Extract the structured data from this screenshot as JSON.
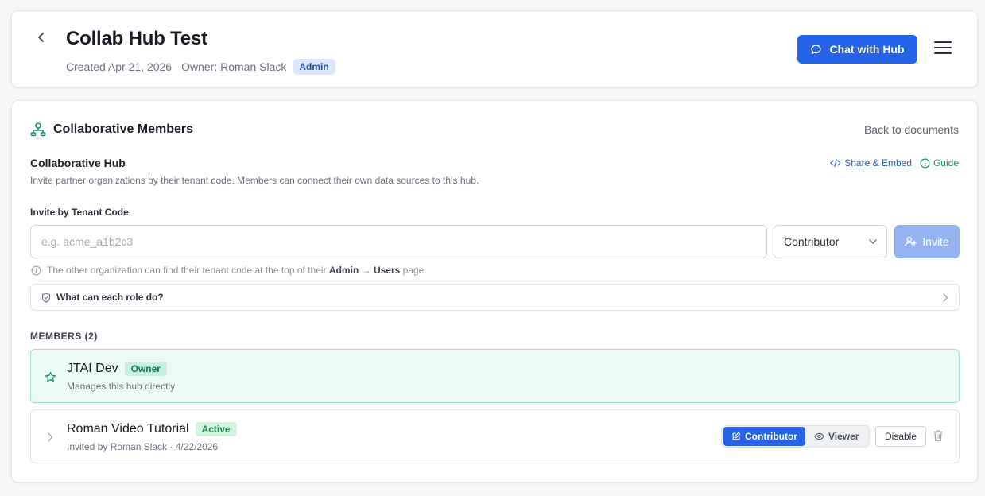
{
  "header": {
    "title": "Collab Hub Test",
    "created": "Created Apr 21, 2026",
    "owner": "Owner: Roman Slack",
    "role_badge": "Admin",
    "chat_button": "Chat with Hub",
    "icons": {
      "back": "chevron-left-icon",
      "chat": "chat-bubble-icon",
      "menu": "hamburger-menu-icon"
    }
  },
  "main": {
    "section_title": "Collaborative Members",
    "back_link": "Back to documents",
    "hub_heading": "Collaborative Hub",
    "hub_description": "Invite partner organizations by their tenant code. Members can connect their own data sources to this hub.",
    "share_embed_link": "Share & Embed",
    "guide_link": "Guide",
    "invite": {
      "label": "Invite by Tenant Code",
      "placeholder": "e.g. acme_a1b2c3",
      "value": "",
      "role_selected": "Contributor",
      "button": "Invite"
    },
    "hint": {
      "prefix": "The other organization can find their tenant code at the top of their",
      "admin": "Admin",
      "arrow": "→",
      "users": "Users",
      "suffix": "page."
    },
    "roles_collapse": "What can each role do?",
    "members_heading": "MEMBERS (2)",
    "members": [
      {
        "name": "JTAI Dev",
        "badge": "Owner",
        "subtitle": "Manages this hub directly"
      },
      {
        "name": "Roman Video Tutorial",
        "badge": "Active",
        "subtitle": "Invited by Roman Slack · 4/22/2026",
        "role_options": [
          "Contributor",
          "Viewer"
        ],
        "role_selected": "Contributor",
        "disable_button": "Disable"
      }
    ]
  },
  "colors": {
    "primary": "#2563e8",
    "primary_disabled": "#93b3f1",
    "owner_bg": "#edfbf5",
    "owner_border": "#9fe3c8",
    "teal_accent": "#1b8e7a",
    "admin_badge_bg": "#dbe7fb"
  }
}
